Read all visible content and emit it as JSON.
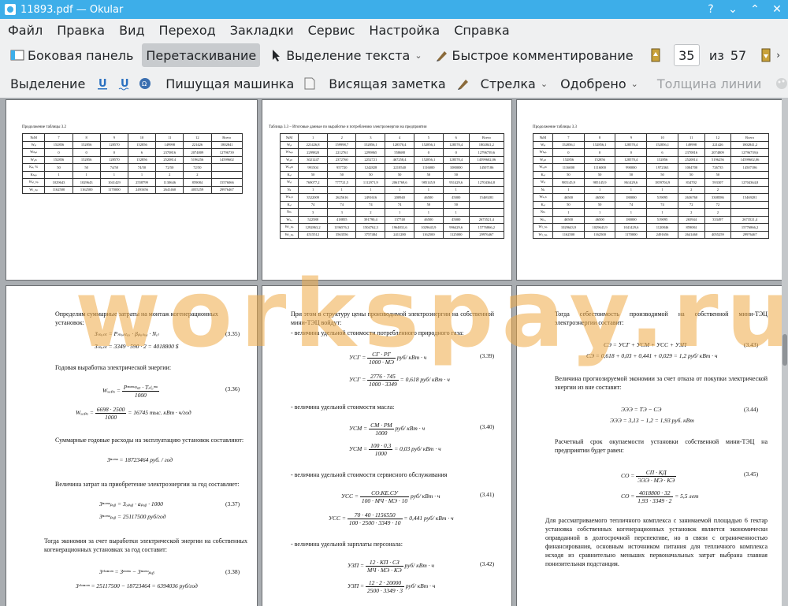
{
  "window": {
    "title": "11893.pdf — Okular"
  },
  "menu": [
    "Файл",
    "Правка",
    "Вид",
    "Переход",
    "Закладки",
    "Сервис",
    "Настройка",
    "Справка"
  ],
  "toolbar1": {
    "sidebar": "Боковая панель",
    "drag": "Перетаскивание",
    "select_text": "Выделение текста",
    "quick_comment": "Быстрое комментирование",
    "page_current": "35",
    "page_of": "из",
    "page_total": "57"
  },
  "toolbar2": {
    "selection": "Выделение",
    "typewriter": "Пишущая машинка",
    "sticky_note": "Висящая заметка",
    "arrow": "Стрелка",
    "approved": "Одобрено",
    "line_width": "Толщина линии"
  },
  "watermark": "workspay.ru",
  "pages": {
    "p1": {
      "caption": "Продолжение таблицы 3.2",
      "header": [
        "№М",
        "7",
        "8",
        "9",
        "10",
        "11",
        "12",
        "Всего"
      ],
      "rows": [
        [
          "Wₑₗ",
          "152856",
          "152856",
          "128570",
          "152856",
          "149998",
          "221426",
          "1802841"
        ],
        [
          "Wₙₑₚ",
          "0",
          "0",
          "0",
          "6",
          "2370816",
          "2074809",
          "12796739"
        ],
        [
          "Wₐₗₙ",
          "152856",
          "152856",
          "128570",
          "152856",
          "2520814",
          "5196256",
          "14599602"
        ],
        [
          "Kₑₗ, %",
          "50",
          "50",
          "74/50",
          "74/50",
          "72/50",
          "72/50",
          ""
        ],
        [
          "Kₙₑₚ",
          "1",
          "1",
          "1",
          "1",
          "2",
          "2",
          ""
        ],
        [
          "Wₑₗ_ₙₚ",
          "1029643",
          "1029643",
          "1041429",
          "2558799",
          "1130646",
          "859084",
          "15576066"
        ],
        [
          "Wₗ_ₙₚ",
          "1162500",
          "1162500",
          "1170000",
          "2491656",
          "2641460",
          "4055259",
          "29976467"
        ]
      ]
    },
    "p2": {
      "caption": "Таблица 3.3 – Итоговые данные по выработке и потреблению электроэнергии на предприятии",
      "header": [
        "№М",
        "1",
        "2",
        "3",
        "4",
        "5",
        "6",
        "Всего"
      ],
      "rows": [
        [
          "Wₑₗ",
          "221426,8",
          "159998,7",
          "152856,1",
          "128570,4",
          "152856,1",
          "128570,4",
          "1802841,2"
        ],
        [
          "Wₙₑₚ",
          "2299820",
          "2212761",
          "2299865",
          "558688",
          "0",
          "0",
          "12796739,6"
        ],
        [
          "Wₐₗₙ",
          "3021247",
          "2372760",
          "2252721",
          "467258,4",
          "152856,1",
          "128570,4",
          "14599602,06"
        ],
        [
          "Wₒₐₘ",
          "991504",
          "957720",
          "1242828",
          "2210540",
          "1116000",
          "1080000",
          "14507186"
        ],
        [
          "Kₑₗ",
          "50",
          "50",
          "50",
          "50",
          "50",
          "50",
          ""
        ],
        [
          "Wₓₗ",
          "769077,2",
          "777721,5",
          "1112971,9",
          "2061769,6",
          "985145,9",
          "951429,6",
          "12704364,8"
        ],
        [
          "Nₖ",
          "1",
          "1",
          "1",
          "1",
          "1",
          "1",
          ""
        ],
        [
          "Wₖₒₙ",
          "3522009",
          "2625616",
          "2491616",
          "200940",
          "46500",
          "45000",
          "15469281"
        ],
        [
          "Kₑₗ",
          "74",
          "74",
          "74",
          "74",
          "50",
          "50",
          ""
        ],
        [
          "Nₜₖ",
          "3",
          "3",
          "2",
          "1",
          "1",
          "1",
          ""
        ],
        [
          "Wₖₒ",
          "522588",
          "418855",
          "391790,4",
          "137748",
          "46500",
          "45000",
          "2673521,4"
        ],
        [
          "Wₗ_ₙₚ",
          "1292863,2",
          "1196576,3",
          "1504762,3",
          "1964831,6",
          "1029643,9",
          "996429,6",
          "15776866,2"
        ],
        [
          "Wₗ_ₙₚ",
          "4515512",
          "3563556",
          "3757484",
          "2411280",
          "1162500",
          "1125000",
          "29976467"
        ]
      ]
    },
    "p3": {
      "caption": "Продолжение таблицы 3.3",
      "header": [
        "№М",
        "7",
        "8",
        "9",
        "10",
        "11",
        "12",
        "Всего"
      ],
      "rows": [
        [
          "Wₑₗ",
          "152856,1",
          "152856,1",
          "128570,4",
          "152856,1",
          "149998",
          "221426",
          "1802841,2"
        ],
        [
          "Wₙₑₚ",
          "0",
          "0",
          "0",
          "6",
          "2370816",
          "2074809",
          "12796739,6"
        ],
        [
          "Wₐₗₙ",
          "152856",
          "152856",
          "128570,4",
          "152856",
          "2520814",
          "5196256",
          "14599602,06"
        ],
        [
          "Wₒₐₘ",
          "1116000",
          "1116000",
          "990000",
          "1972363",
          "1004700",
          "726735",
          "14507186"
        ],
        [
          "Kₑₗ",
          "50",
          "50",
          "50",
          "50",
          "50",
          "50",
          ""
        ],
        [
          "Wₓₗ",
          "985145,9",
          "985145,9",
          "861429,6",
          "1859704,9",
          "834702",
          "593307",
          "12704364,8"
        ],
        [
          "Nₖ",
          "1",
          "1",
          "1",
          "1",
          "2",
          "2",
          ""
        ],
        [
          "Wₖₒₙ",
          "46500",
          "46500",
          "180000",
          "519095",
          "2636760",
          "3308586",
          "15469281"
        ],
        [
          "Kₑₗ",
          "50",
          "50",
          "74",
          "74",
          "72",
          "72",
          ""
        ],
        [
          "Nₜₖ",
          "1",
          "1",
          "1",
          "1",
          "2",
          "2",
          ""
        ],
        [
          "Wₖₒ",
          "46500",
          "46500",
          "180000",
          "519095",
          "265944",
          "333497",
          "2673521,4"
        ],
        [
          "Wₗ_ₙₚ",
          "1029643,9",
          "1029643,9",
          "1041429,6",
          "1120846",
          "859084",
          "",
          "15776866,2"
        ],
        [
          "Wₗ_ₙₚ",
          "1162500",
          "1162500",
          "1170000",
          "2491656",
          "2641460",
          "4055259",
          "29976467"
        ]
      ]
    },
    "p4": {
      "t1": "Определим суммарные затраты на монтаж когенерационных установок:",
      "e1": "Зₘₒₙₜ = Pₘₒₙₜₐₓ · βₚₐₙₒₐ · Nₑₗ",
      "n1": "(3.35)",
      "e2": "Зₘₒₙₜ = 3349 · 590 · 2 = 4018800 $",
      "t2": "Годовая выработка электрической энергии:",
      "e3a": "Wₓₐₚₐ =",
      "e3num": "Pⁿᵒᵐᵘᵍₛₜ · Tₙᵗₒᵐᵘ",
      "e3den": "1000",
      "n3": "(3.36)",
      "e4a": "Wₓₐₚₐ =",
      "e4num": "6698 · 2500",
      "e4den": "1000",
      "e4b": "= 16745 тыс. кВт · ч/год",
      "t3": "Суммарные годовые расходы на эксплуатацию установок составляют:",
      "e5": "Зⁿᵒᵐᵘ = 18723464 руб. / год",
      "t4": "Величина затрат на приобретение электроэнергии за год составляет:",
      "e6": "Зⁿᵒᵐᵘₚᵤᵦ = Зₒₚᵤᵦ · aₚᵤᵦ · 1000",
      "n6": "(3.37)",
      "e7": "Зⁿᵒᵐᵘₚᵤᵦ = 25117500 руб/год",
      "t5": "Тогда экономия за счет выработки электрической энергии на собственных когенерационных установках за год составит:",
      "e8": "Зᵉᵏᵒⁿᵒᵐ = Зⁿᵒᵐᵘ − Зⁿᵒᵐᵘₚᵤᵦ",
      "n8": "(3.38)",
      "e9": "Зᵉᵏᵒⁿᵒᵐ = 25117500 − 18723464 = 6394036 руб/год"
    },
    "p5": {
      "t1": "При этом в структуру цены производимой электроэнергии на собственной мини-ТЭЦ войдут:",
      "t2": "- величина удельной стоимости потребленного природного газа:",
      "e1a": "УСГ =",
      "e1num": "СГ · РГ",
      "e1den": "1000 · МЭ",
      "e1b": "руб/ кВт · ч",
      "n1": "(3.39)",
      "e2a": "УСГ =",
      "e2num": "2776 · 745",
      "e2den": "1000 · 3349",
      "e2b": "= 0,618 руб/ кВт · ч",
      "t3": "- величина удельной стоимости масла:",
      "e3a": "УСМ =",
      "e3num": "СМ · РМ",
      "e3den": "1000",
      "e3b": "руб/ кВт · ч",
      "n3": "(3.40)",
      "e4a": "УСМ =",
      "e4num": "100 · 0,3",
      "e4den": "1000",
      "e4b": "= 0,03 руб/ кВт · ч",
      "t4": "- величина удельной стоимости сервисного обслуживания",
      "e5a": "УСС =",
      "e5num": "СО.КЕ.СУ",
      "e5den": "100 · МЧ · МЭ · 10",
      "e5b": "руб/ кВт · ч",
      "n5": "(3.41)",
      "e6a": "УСС =",
      "e6num": "70 · 40 · 1156550",
      "e6den": "100 · 2500 · 3349 · 10",
      "e6b": "= 0,441 руб/ кВт · ч",
      "t5": "- величина удельной зарплаты персонала:",
      "e7a": "УЗП =",
      "e7num": "12 · КП · СЗ",
      "e7den": "МЧ · МЭ · КЭ",
      "e7b": "руб/ кВт · ч",
      "n7": "(3.42)",
      "e8a": "УЗП =",
      "e8num": "12 · 2 · 20000",
      "e8den": "2500 · 3349 · 3",
      "e8b": "руб/ кВт · ч"
    },
    "p6": {
      "t1": "Тогда себестоимость производимой на собственной мини-ТЭЦ электроэнергии составит:",
      "e1": "СЭ = УСГ + УСМ + УСС + УЗП",
      "n1": "(3.43)",
      "e2": "СЭ = 0,618 + 0,03 + 0,441 + 0,029 = 1,2 руб/ кВт · ч",
      "t2": "Величина прогнозируемой экономии за счет отказа от покупки электрической энергии из вне составит:",
      "e3": "ЭЭЭ = ТЭ − СЭ",
      "n3": "(3.44)",
      "e4": "ЭЭЭ = 3,13 − 1,2 = 1,93 руб. кВт",
      "t3": "Расчетный срок окупаемости установки собственной мини-ТЭЦ на предприятии будет равен:",
      "e5a": "СО =",
      "e5num": "СП · КД",
      "e5den": "ЭЭЭ · МЭ · КЭ",
      "n5": "(3.45)",
      "e6a": "СО =",
      "e6num": "4018800 · 32",
      "e6den": "1,93 · 3349 · 2",
      "e6b": "= 5,5 лет",
      "t4": "Для рассматриваемого тепличного комплекса с занимаемой площадью 6 гектар установка собственных когенерационных установок является экономически оправданной в долгосрочной перспективе, но в связи с ограниченностью финансирования, основным источником питания для тепличного комплекса исходя из сравнительно меньших первоначальных затрат выбрана главная понизительная подстанция."
    }
  }
}
